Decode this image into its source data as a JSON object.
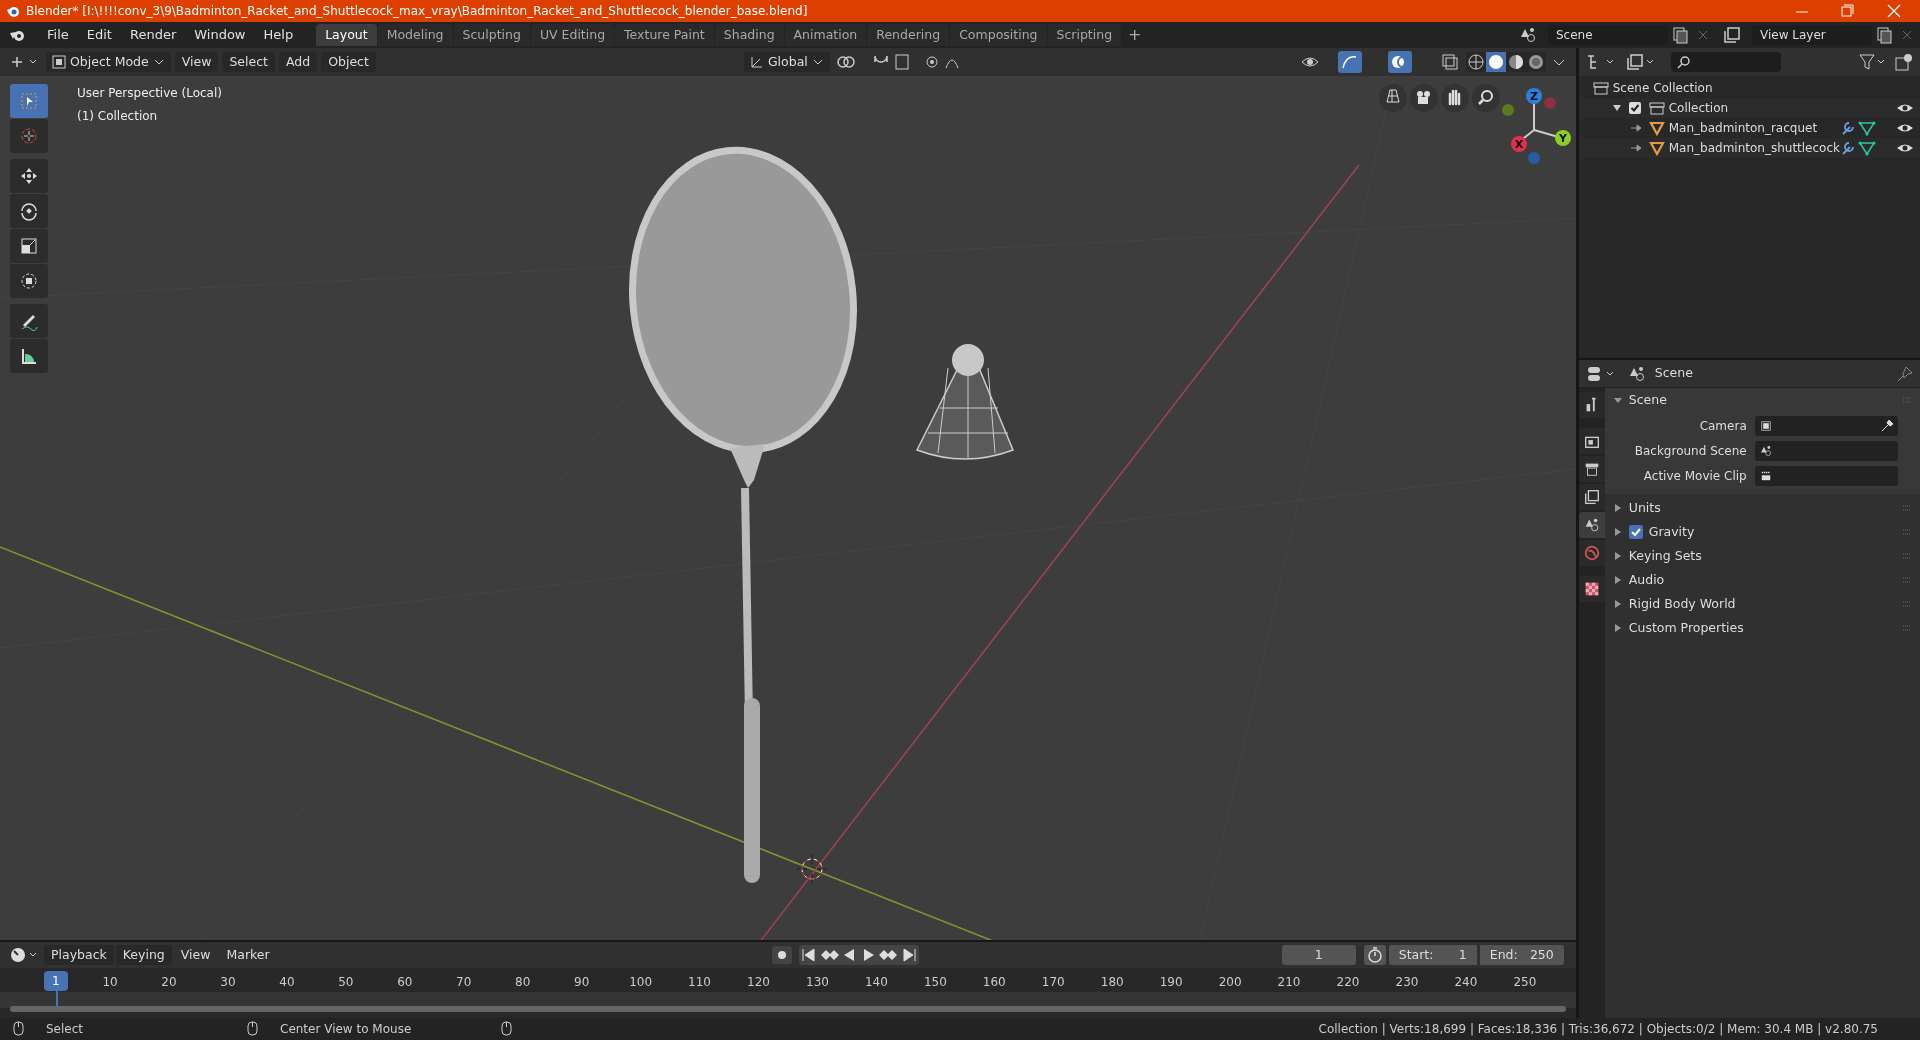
{
  "window": {
    "title": "Blender* [I:\\!!!!conv_3\\9\\Badminton_Racket_and_Shuttlecock_max_vray\\Badminton_Racket_and_Shuttlecock_blender_base.blend]"
  },
  "menu": [
    "File",
    "Edit",
    "Render",
    "Window",
    "Help"
  ],
  "workspace_tabs": [
    {
      "label": "Layout",
      "selected": true
    },
    {
      "label": "Modeling",
      "selected": false
    },
    {
      "label": "Sculpting",
      "selected": false
    },
    {
      "label": "UV Editing",
      "selected": false
    },
    {
      "label": "Texture Paint",
      "selected": false
    },
    {
      "label": "Shading",
      "selected": false
    },
    {
      "label": "Animation",
      "selected": false
    },
    {
      "label": "Rendering",
      "selected": false
    },
    {
      "label": "Compositing",
      "selected": false
    },
    {
      "label": "Scripting",
      "selected": false
    }
  ],
  "add_tab": "+",
  "scene_field": "Scene",
  "view_layer_field": "View Layer",
  "viewport": {
    "mode": "Object Mode",
    "menus": [
      "View",
      "Select",
      "Add",
      "Object"
    ],
    "orientation": "Global",
    "overlay": [
      "User Perspective (Local)",
      "(1) Collection"
    ],
    "tools": [
      {
        "kind": "select",
        "selected": true
      },
      {
        "kind": "cursor",
        "selected": false
      },
      {
        "kind": "move",
        "selected": false
      },
      {
        "kind": "rotate",
        "selected": false
      },
      {
        "kind": "scale",
        "selected": false
      },
      {
        "kind": "transform",
        "selected": false
      },
      {
        "kind": "annotate",
        "selected": false
      },
      {
        "kind": "measure",
        "selected": false
      }
    ],
    "gizmo_axes": [
      "Z",
      "Y",
      "X"
    ]
  },
  "outliner": {
    "items": [
      {
        "label": "Scene Collection",
        "children": [
          {
            "label": "Collection",
            "checked": true,
            "expanded": true,
            "children": [
              {
                "label": "Man_badminton_racquet"
              },
              {
                "label": "Man_badminton_shuttlecock"
              }
            ]
          }
        ]
      }
    ]
  },
  "properties": {
    "title": "Scene",
    "tabs": [
      {
        "kind": "tool",
        "selected": false
      },
      {
        "kind": "render",
        "selected": false
      },
      {
        "kind": "output",
        "selected": false
      },
      {
        "kind": "view_layer",
        "selected": false
      },
      {
        "kind": "scene",
        "selected": true
      },
      {
        "kind": "world",
        "selected": false
      },
      {
        "kind": "texture",
        "selected": false
      }
    ],
    "sections": [
      {
        "label": "Scene",
        "kind": "plain",
        "expanded": true,
        "fields": [
          {
            "label": "Camera",
            "kind": "camera"
          },
          {
            "label": "Background Scene",
            "kind": "scene"
          },
          {
            "label": "Active Movie Clip",
            "kind": "clip"
          }
        ]
      },
      {
        "label": "Units",
        "kind": "plain",
        "expanded": false
      },
      {
        "label": "Gravity",
        "kind": "checkbox",
        "checked": true,
        "expanded": false
      },
      {
        "label": "Keying Sets",
        "kind": "plain",
        "expanded": false
      },
      {
        "label": "Audio",
        "kind": "plain",
        "expanded": false
      },
      {
        "label": "Rigid Body World",
        "kind": "plain",
        "expanded": false
      },
      {
        "label": "Custom Properties",
        "kind": "plain",
        "expanded": false
      }
    ]
  },
  "timeline": {
    "menus": [
      "Playback",
      "Keying",
      "View",
      "Marker"
    ],
    "current_frame": "1",
    "start_label": "Start:",
    "start": "1",
    "end_label": "End:",
    "end": "250",
    "ruler": [
      "1",
      "10",
      "20",
      "30",
      "40",
      "50",
      "60",
      "70",
      "80",
      "90",
      "100",
      "110",
      "120",
      "130",
      "140",
      "150",
      "160",
      "170",
      "180",
      "190",
      "200",
      "210",
      "220",
      "230",
      "240",
      "250"
    ]
  },
  "status_bar": {
    "hints": [
      "Select",
      "Center View to Mouse"
    ],
    "stats": "Collection | Verts:18,699 | Faces:18,336 | Tris:36,672 | Objects:0/2 | Mem: 30.4 MB | v2.80.75"
  }
}
